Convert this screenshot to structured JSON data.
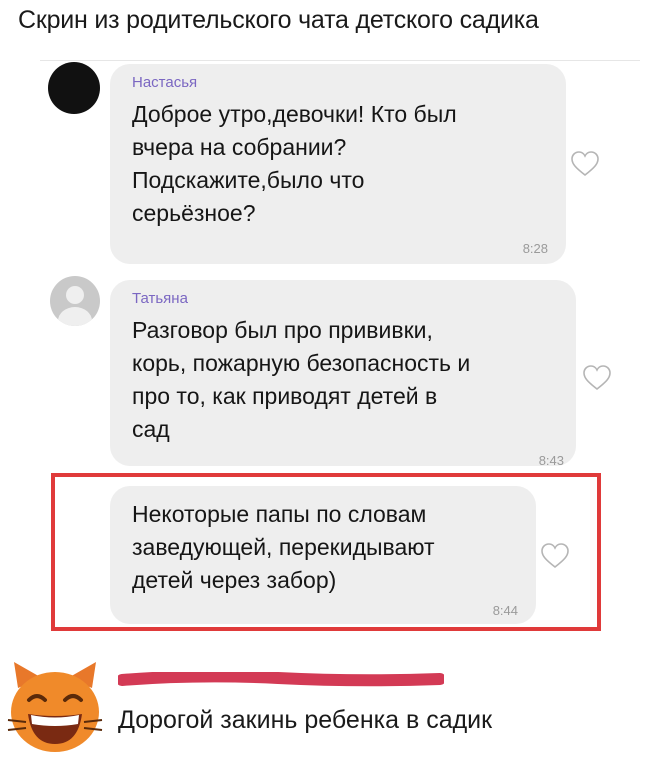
{
  "caption_top": "Скрин из родительского чата детского садика",
  "messages": [
    {
      "sender": "Настасья",
      "text": "Доброе утро,девочки! Кто был\nвчера на собрании?\nПодскажите,было что\nсерьёзное?",
      "time": "8:28",
      "avatar": "black-avatar"
    },
    {
      "sender": "Татьяна",
      "text": "Разговор был про прививки,\nкорь, пожарную безопасность и\nпро то, как приводят детей в\nсад",
      "time": "8:43",
      "avatar": "default-user-avatar"
    },
    {
      "sender": "",
      "text": "Некоторые папы по словам\nзаведующей, перекидывают\nдетей через забор)",
      "time": "8:44",
      "highlighted": true
    }
  ],
  "caption_bottom": "Дорогой закинь ребенка в садик",
  "colors": {
    "bubble": "#eeeeee",
    "sender_name": "#7b67c2",
    "highlight_border": "#e03a3a",
    "emoji_face": "#f08a2a"
  },
  "icons": [
    "heart-icon",
    "grinning-cat-emoji"
  ]
}
